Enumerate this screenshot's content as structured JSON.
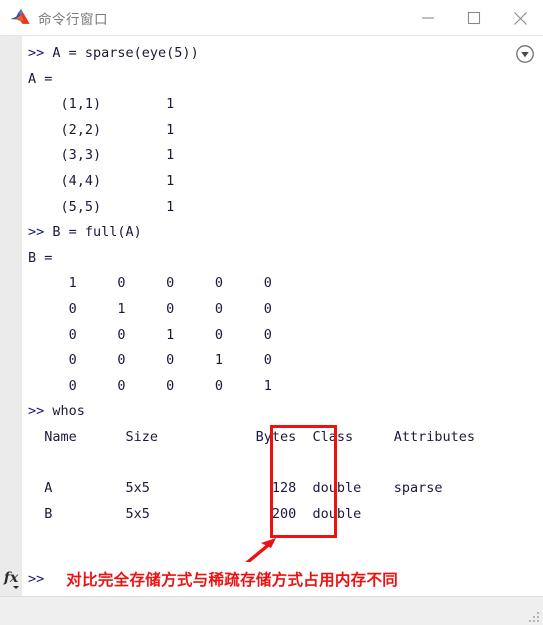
{
  "window": {
    "title": "命令行窗口",
    "app_icon": "matlab-membrane-icon",
    "controls": {
      "minimize": "minimize-icon",
      "maximize": "maximize-icon",
      "close": "close-icon"
    }
  },
  "console": {
    "scroll_badge": "scroll-to-bottom-icon",
    "lines": [
      ">> A = sparse(eye(5))",
      "A =",
      "    (1,1)        1",
      "    (2,2)        1",
      "    (3,3)        1",
      "    (4,4)        1",
      "    (5,5)        1",
      ">> B = full(A)",
      "B =",
      "     1     0     0     0     0",
      "     0     1     0     0     0",
      "     0     0     1     0     0",
      "     0     0     0     1     0",
      "     0     0     0     0     1",
      ">> whos",
      "  Name      Size            Bytes  Class     Attributes",
      "",
      "  A         5x5               128  double    sparse",
      "  B         5x5               200  double"
    ],
    "commands": [
      "A = sparse(eye(5))",
      "B = full(A)",
      "whos"
    ],
    "sparse_entries": [
      {
        "index": "(1,1)",
        "value": "1"
      },
      {
        "index": "(2,2)",
        "value": "1"
      },
      {
        "index": "(3,3)",
        "value": "1"
      },
      {
        "index": "(4,4)",
        "value": "1"
      },
      {
        "index": "(5,5)",
        "value": "1"
      }
    ],
    "full_matrix": [
      [
        "1",
        "0",
        "0",
        "0",
        "0"
      ],
      [
        "0",
        "1",
        "0",
        "0",
        "0"
      ],
      [
        "0",
        "0",
        "1",
        "0",
        "0"
      ],
      [
        "0",
        "0",
        "0",
        "1",
        "0"
      ],
      [
        "0",
        "0",
        "0",
        "0",
        "1"
      ]
    ],
    "whos_table": {
      "headers": [
        "Name",
        "Size",
        "Bytes",
        "Class",
        "Attributes"
      ],
      "rows": [
        {
          "name": "A",
          "size": "5x5",
          "bytes": "128",
          "class": "double",
          "attributes": "sparse"
        },
        {
          "name": "B",
          "size": "5x5",
          "bytes": "200",
          "class": "double"
        }
      ]
    }
  },
  "annotations": {
    "highlight_box": "bytes-column-highlight",
    "arrow": "red-arrow-icon",
    "note": "对比完全存储方式与稀疏存储方式占用内存不同",
    "color": "#ee1111"
  },
  "promptbar": {
    "fx_label": "fx",
    "chevrons": ">>"
  },
  "statusbar": {
    "resize_grip": "resize-grip-icon"
  }
}
